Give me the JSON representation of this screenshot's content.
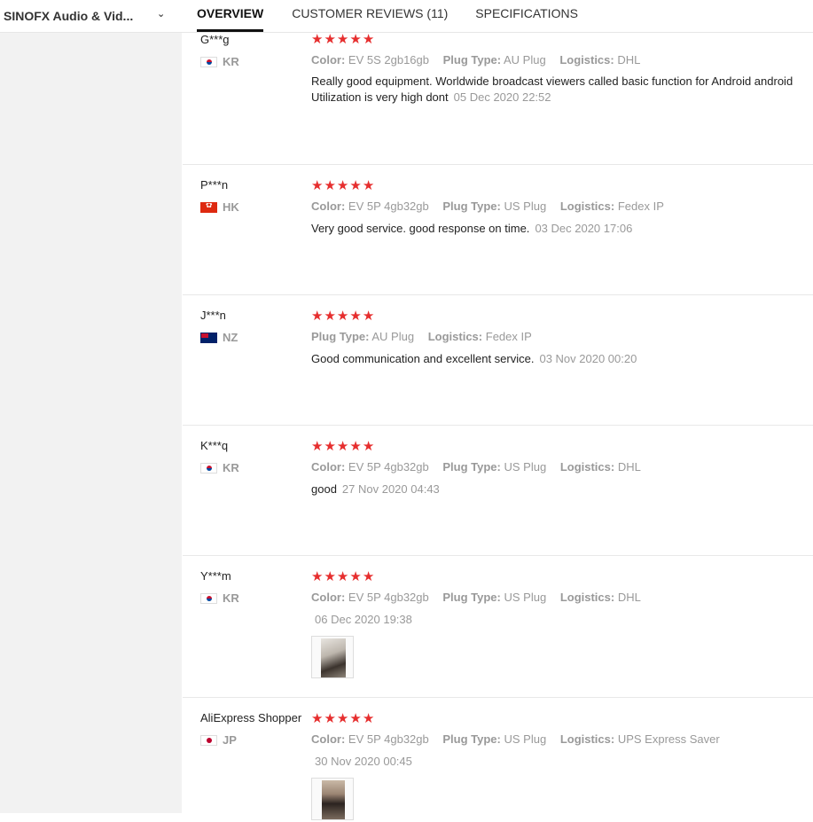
{
  "header": {
    "store_name": "SINOFX Audio & Vid...",
    "tabs": [
      {
        "label": "OVERVIEW",
        "active": true
      },
      {
        "label": "CUSTOMER REVIEWS (11)",
        "active": false
      },
      {
        "label": "SPECIFICATIONS",
        "active": false
      }
    ]
  },
  "colors": {
    "accent": "#111111",
    "star": "#e62e2e",
    "sidebar_bg": "#f2f2f2"
  },
  "reviews": [
    {
      "user": "G***g",
      "country": "KR",
      "flag": "kr-flag-icon",
      "rating": 5,
      "attrs": {
        "color_label": "Color:",
        "color": "EV 5S 2gb16gb",
        "plug_label": "Plug Type:",
        "plug": "AU Plug",
        "logistics_label": "Logistics:",
        "logistics": "DHL"
      },
      "text": "Really good equipment. Worldwide broadcast viewers called basic function for Android android Utilization is very high dont",
      "date": "05 Dec 2020 22:52"
    },
    {
      "user": "P***n",
      "country": "HK",
      "flag": "hk-flag-icon",
      "rating": 5,
      "attrs": {
        "color_label": "Color:",
        "color": "EV 5P 4gb32gb",
        "plug_label": "Plug Type:",
        "plug": "US Plug",
        "logistics_label": "Logistics:",
        "logistics": "Fedex IP"
      },
      "text": "Very good service. good response on time.",
      "date": "03 Dec 2020 17:06"
    },
    {
      "user": "J***n",
      "country": "NZ",
      "flag": "nz-flag-icon",
      "rating": 5,
      "attrs": {
        "plug_label": "Plug Type:",
        "plug": "AU Plug",
        "logistics_label": "Logistics:",
        "logistics": "Fedex IP"
      },
      "text": "Good communication and excellent service.",
      "date": "03 Nov 2020 00:20"
    },
    {
      "user": "K***q",
      "country": "KR",
      "flag": "kr-flag-icon",
      "rating": 5,
      "attrs": {
        "color_label": "Color:",
        "color": "EV 5P 4gb32gb",
        "plug_label": "Plug Type:",
        "plug": "US Plug",
        "logistics_label": "Logistics:",
        "logistics": "DHL"
      },
      "text": "good",
      "date": "27 Nov 2020 04:43"
    },
    {
      "user": "Y***m",
      "country": "KR",
      "flag": "kr-flag-icon",
      "rating": 5,
      "attrs": {
        "color_label": "Color:",
        "color": "EV 5P 4gb32gb",
        "plug_label": "Plug Type:",
        "plug": "US Plug",
        "logistics_label": "Logistics:",
        "logistics": "DHL"
      },
      "text": "",
      "date": "06 Dec 2020 19:38",
      "has_photo": true
    },
    {
      "user": "AliExpress Shopper",
      "country": "JP",
      "flag": "jp-flag-icon",
      "rating": 5,
      "attrs": {
        "color_label": "Color:",
        "color": "EV 5P 4gb32gb",
        "plug_label": "Plug Type:",
        "plug": "US Plug",
        "logistics_label": "Logistics:",
        "logistics": "UPS Express Saver"
      },
      "text": "",
      "date": "30 Nov 2020 00:45",
      "has_photo": true
    }
  ]
}
